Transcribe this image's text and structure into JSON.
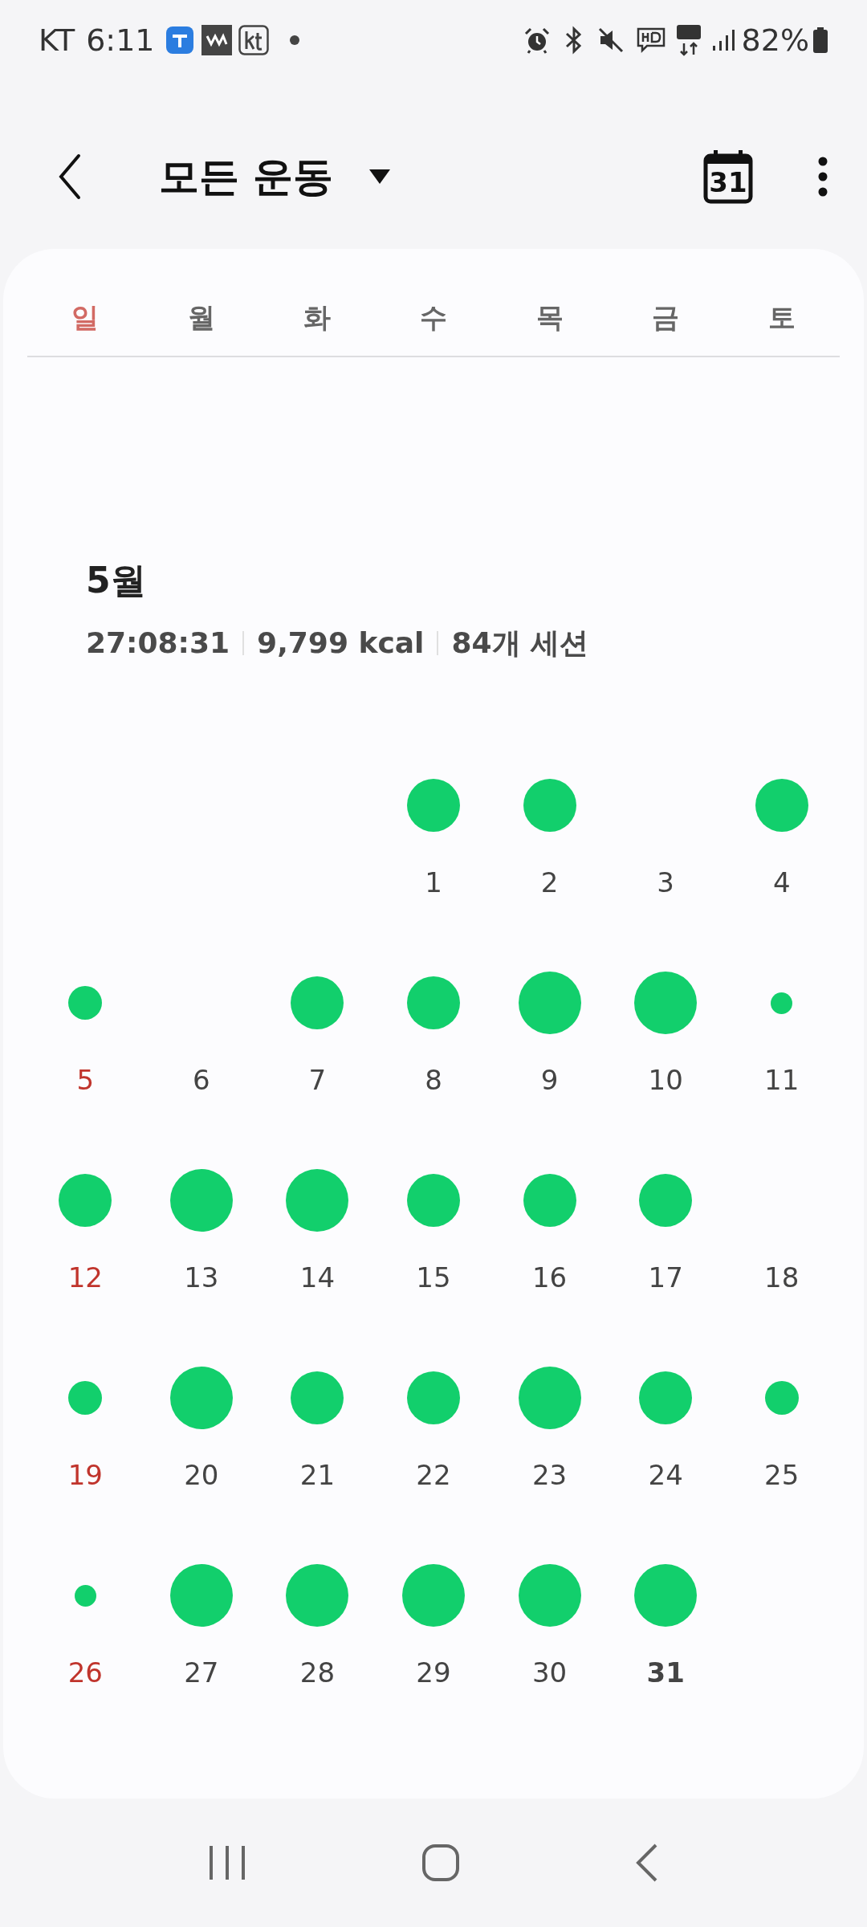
{
  "status_bar": {
    "carrier": "KT",
    "time": "6:11",
    "battery": "82%"
  },
  "header": {
    "title": "모든 운동",
    "calendar_day": "31"
  },
  "weekdays": [
    {
      "label": "일",
      "sunday": true
    },
    {
      "label": "월",
      "sunday": false
    },
    {
      "label": "화",
      "sunday": false
    },
    {
      "label": "수",
      "sunday": false
    },
    {
      "label": "목",
      "sunday": false
    },
    {
      "label": "금",
      "sunday": false
    },
    {
      "label": "토",
      "sunday": false
    }
  ],
  "month": {
    "title": "5월",
    "stats": [
      "27:08:31",
      "9,799 kcal",
      "84개 세션"
    ]
  },
  "weeks": [
    [
      {
        "kind": "blank"
      },
      {
        "kind": "blank"
      },
      {
        "kind": "blank"
      },
      {
        "kind": "medium",
        "day": "1",
        "sunday": false,
        "today": false
      },
      {
        "kind": "medium",
        "day": "2",
        "sunday": false,
        "today": false
      },
      {
        "kind": "rest",
        "day": "3",
        "sunday": false,
        "today": false
      },
      {
        "kind": "medium",
        "day": "4",
        "sunday": false,
        "today": false
      }
    ],
    [
      {
        "kind": "small",
        "day": "5",
        "sunday": true,
        "today": false
      },
      {
        "kind": "rest",
        "day": "6",
        "sunday": false,
        "today": false
      },
      {
        "kind": "medium",
        "day": "7",
        "sunday": false,
        "today": false
      },
      {
        "kind": "medium",
        "day": "8",
        "sunday": false,
        "today": false
      },
      {
        "kind": "large",
        "day": "9",
        "sunday": false,
        "today": false
      },
      {
        "kind": "large",
        "day": "10",
        "sunday": false,
        "today": false
      },
      {
        "kind": "tiny",
        "day": "11",
        "sunday": false,
        "today": false
      }
    ],
    [
      {
        "kind": "medium",
        "day": "12",
        "sunday": true,
        "today": false
      },
      {
        "kind": "large",
        "day": "13",
        "sunday": false,
        "today": false
      },
      {
        "kind": "large",
        "day": "14",
        "sunday": false,
        "today": false
      },
      {
        "kind": "medium",
        "day": "15",
        "sunday": false,
        "today": false
      },
      {
        "kind": "medium",
        "day": "16",
        "sunday": false,
        "today": false
      },
      {
        "kind": "medium",
        "day": "17",
        "sunday": false,
        "today": false
      },
      {
        "kind": "rest",
        "day": "18",
        "sunday": false,
        "today": false
      }
    ],
    [
      {
        "kind": "small",
        "day": "19",
        "sunday": true,
        "today": false
      },
      {
        "kind": "large",
        "day": "20",
        "sunday": false,
        "today": false
      },
      {
        "kind": "medium",
        "day": "21",
        "sunday": false,
        "today": false
      },
      {
        "kind": "medium",
        "day": "22",
        "sunday": false,
        "today": false
      },
      {
        "kind": "large",
        "day": "23",
        "sunday": false,
        "today": false
      },
      {
        "kind": "medium",
        "day": "24",
        "sunday": false,
        "today": false
      },
      {
        "kind": "small",
        "day": "25",
        "sunday": false,
        "today": false
      }
    ],
    [
      {
        "kind": "tiny",
        "day": "26",
        "sunday": true,
        "today": false
      },
      {
        "kind": "large",
        "day": "27",
        "sunday": false,
        "today": false
      },
      {
        "kind": "large",
        "day": "28",
        "sunday": false,
        "today": false
      },
      {
        "kind": "large",
        "day": "29",
        "sunday": false,
        "today": false
      },
      {
        "kind": "large",
        "day": "30",
        "sunday": false,
        "today": false
      },
      {
        "kind": "large",
        "day": "31",
        "sunday": false,
        "today": true
      },
      {
        "kind": "blank"
      }
    ]
  ]
}
